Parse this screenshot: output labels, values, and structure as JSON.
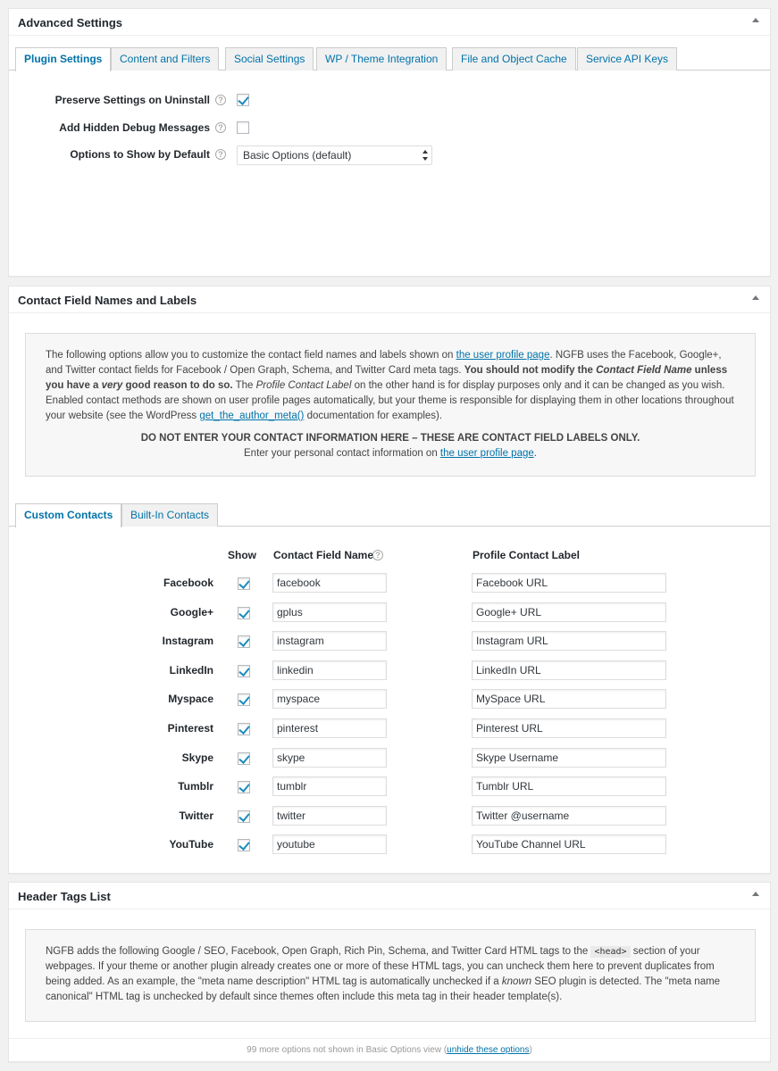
{
  "advanced": {
    "title": "Advanced Settings",
    "tabs": [
      "Plugin Settings",
      "Content and Filters",
      "Social Settings",
      "WP / Theme Integration",
      "File and Object Cache",
      "Service API Keys"
    ],
    "rows": [
      {
        "label": "Preserve Settings on Uninstall",
        "checked": true
      },
      {
        "label": "Add Hidden Debug Messages",
        "checked": false
      },
      {
        "label": "Options to Show by Default",
        "select_value": "Basic Options (default)"
      }
    ]
  },
  "contacts": {
    "title": "Contact Field Names and Labels",
    "info": {
      "t1": "The following options allow you to customize the contact field names and labels shown on ",
      "link1": "the user profile page",
      "t2": ". NGFB uses the Facebook, Google+, and Twitter contact fields for Facebook / Open Graph, Schema, and Twitter Card meta tags. ",
      "b1": "You should not modify the ",
      "bi1": "Contact Field Name",
      "b2": " unless you have a ",
      "bi2": "very",
      "b3": " good reason to do so.",
      "t3": " The ",
      "i1": "Profile Contact Label",
      "t4": " on the other hand is for display purposes only and it can be changed as you wish. Enabled contact methods are shown on user profile pages automatically, but your theme is responsible for displaying them in other locations throughout your website (see the WordPress ",
      "link2": "get_the_author_meta()",
      "t5": " documentation for examples).",
      "warning": "DO NOT ENTER YOUR CONTACT INFORMATION HERE – THESE ARE CONTACT FIELD LABELS ONLY.",
      "enter_text": "Enter your personal contact information on ",
      "enter_link": "the user profile page",
      "enter_end": "."
    },
    "tabs": [
      "Custom Contacts",
      "Built-In Contacts"
    ],
    "headers": {
      "show": "Show",
      "field_name": "Contact Field Name",
      "label": "Profile Contact Label"
    },
    "rows": [
      {
        "name": "Facebook",
        "show": true,
        "field": "facebook",
        "label": "Facebook URL"
      },
      {
        "name": "Google+",
        "show": true,
        "field": "gplus",
        "label": "Google+ URL"
      },
      {
        "name": "Instagram",
        "show": true,
        "field": "instagram",
        "label": "Instagram URL"
      },
      {
        "name": "LinkedIn",
        "show": true,
        "field": "linkedin",
        "label": "LinkedIn URL"
      },
      {
        "name": "Myspace",
        "show": true,
        "field": "myspace",
        "label": "MySpace URL"
      },
      {
        "name": "Pinterest",
        "show": true,
        "field": "pinterest",
        "label": "Pinterest URL"
      },
      {
        "name": "Skype",
        "show": true,
        "field": "skype",
        "label": "Skype Username"
      },
      {
        "name": "Tumblr",
        "show": true,
        "field": "tumblr",
        "label": "Tumblr URL"
      },
      {
        "name": "Twitter",
        "show": true,
        "field": "twitter",
        "label": "Twitter @username"
      },
      {
        "name": "YouTube",
        "show": true,
        "field": "youtube",
        "label": "YouTube Channel URL"
      }
    ]
  },
  "header_tags": {
    "title": "Header Tags List",
    "t1": "NGFB adds the following Google / SEO, Facebook, Open Graph, Rich Pin, Schema, and Twitter Card HTML tags to the ",
    "code": "<head>",
    "t2": " section of your webpages. If your theme or another plugin already creates one or more of these HTML tags, you can uncheck them here to prevent duplicates from being added. As an example, the \"meta name description\" HTML tag is automatically unchecked if a ",
    "em": "known",
    "t3": " SEO plugin is detected. The \"meta name canonical\" HTML tag is unchecked by default since themes often include this meta tag in their header template(s).",
    "footer_text": "99 more options not shown in Basic Options view (",
    "footer_link": "unhide these options",
    "footer_end": ")"
  }
}
